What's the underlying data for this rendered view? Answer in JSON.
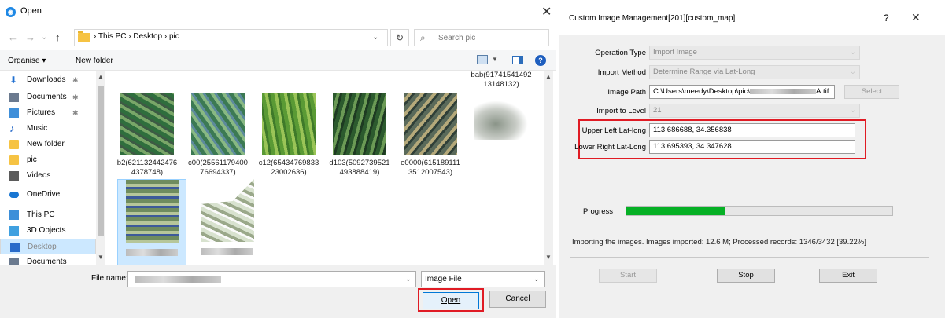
{
  "open_dialog": {
    "title": "Open",
    "close_glyph": "✕",
    "nav": {
      "back": "←",
      "forward": "→",
      "recent": "⌄",
      "up": "↑"
    },
    "breadcrumb": "›  This PC  ›  Desktop  ›  pic",
    "search_placeholder": "Search pic",
    "toolbar": {
      "organise": "Organise ▾",
      "new_folder": "New folder"
    },
    "sidebar": [
      {
        "label": "Downloads",
        "icon": "download-icon",
        "pinned": true,
        "color": "#1f6fd1"
      },
      {
        "label": "Documents",
        "icon": "document-icon",
        "pinned": true,
        "color": "#6b7a8f"
      },
      {
        "label": "Pictures",
        "icon": "pictures-icon",
        "pinned": true,
        "color": "#3f8fd9"
      },
      {
        "label": "Music",
        "icon": "music-icon",
        "pinned": false,
        "color": "#2a6bc9"
      },
      {
        "label": "New folder",
        "icon": "folder-icon",
        "pinned": false,
        "color": "#f6c343"
      },
      {
        "label": "pic",
        "icon": "folder-icon",
        "pinned": false,
        "color": "#f6c343"
      },
      {
        "label": "Videos",
        "icon": "videos-icon",
        "pinned": false,
        "color": "#5b5b5b"
      },
      {
        "label": "OneDrive",
        "icon": "cloud-icon",
        "pinned": false,
        "color": "#1976d2"
      },
      {
        "label": "This PC",
        "icon": "computer-icon",
        "pinned": false,
        "color": "#3d8fd9"
      },
      {
        "label": "3D Objects",
        "icon": "cube-icon",
        "pinned": false,
        "color": "#3fa0e0"
      },
      {
        "label": "Desktop",
        "icon": "desktop-icon",
        "pinned": false,
        "color": "#2a6bc9"
      },
      {
        "label": "Documents",
        "icon": "document-icon",
        "pinned": false,
        "color": "#6b7a8f"
      }
    ],
    "files": [
      {
        "caption": "b2(621132442476\n4378748)",
        "colors": [
          "#2f6e3d",
          "#79a668",
          "#3d5a44"
        ]
      },
      {
        "caption": "c00(25561179400\n76694337)",
        "colors": [
          "#3c7a53",
          "#88b883",
          "#5c8a9c"
        ]
      },
      {
        "caption": "c12(65434769833\n23002636)",
        "colors": [
          "#5a9a35",
          "#9ac457",
          "#3f7a2a"
        ]
      },
      {
        "caption": "d103(5092739521\n493888419)",
        "colors": [
          "#2c5a2e",
          "#6b9a55",
          "#1e3a22"
        ]
      },
      {
        "caption": "e0000(615189111\n3512007543)",
        "colors": [
          "#5a6a5a",
          "#b5a97a",
          "#2f3f38"
        ]
      },
      {
        "caption": "bab(91741541492\n13148132)",
        "colors": [
          "#8a9488",
          "#c8ccc6",
          "#5c6b5a"
        ]
      },
      {
        "caption": "",
        "colors": [
          "#6f8c5f",
          "#b6c69a",
          "#3d5a9a"
        ]
      },
      {
        "caption": "",
        "colors": [
          "#d8e2cf",
          "#9aa88a",
          "#fafafa"
        ]
      }
    ],
    "file_name_label": "File name:",
    "file_type": "Image File",
    "open_button": "Open",
    "cancel_button": "Cancel"
  },
  "cim": {
    "title": "Custom Image Management[201][custom_map]",
    "help_glyph": "?",
    "close_glyph": "✕",
    "operation_type_label": "Operation Type",
    "operation_type_value": "Import Image",
    "import_method_label": "Import Method",
    "import_method_value": "Determine Range via Lat-Long",
    "image_path_label": "Image Path",
    "image_path_prefix": "C:\\Users\\meedy\\Desktop\\pic\\",
    "image_path_suffix": "A.tif",
    "select_button": "Select",
    "import_level_label": "Import to Level",
    "import_level_value": "21",
    "upper_left_label": "Upper Left Lat-long",
    "upper_left_value": "113.686688, 34.356838",
    "lower_right_label": "Lower Right Lat-Long",
    "lower_right_value": "113.695393, 34.347628",
    "progress_label": "Progress",
    "progress_fraction": 0.37,
    "status_text": "Importing the images. Images imported: 12.6 M; Processed records: 1346/3432 [39.22%]",
    "start_button": "Start",
    "stop_button": "Stop",
    "exit_button": "Exit"
  }
}
